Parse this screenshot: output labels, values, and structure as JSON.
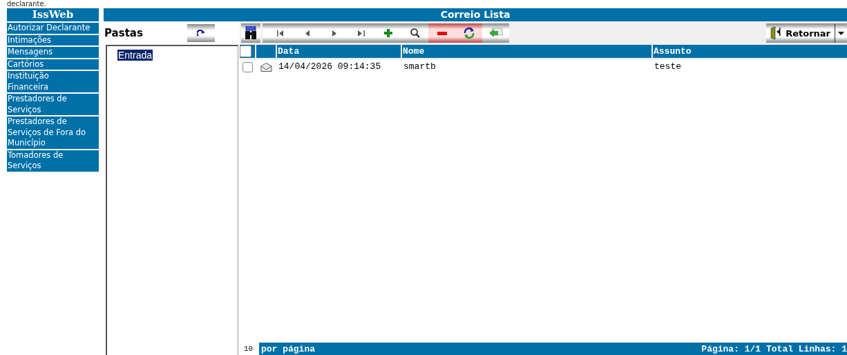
{
  "top_text": "declarante.",
  "sidebar": {
    "title": "IssWeb",
    "items": [
      {
        "label": "Autorizar Declarante"
      },
      {
        "label": "Intimações"
      },
      {
        "label": "Mensagens"
      },
      {
        "label": "Cartórios"
      },
      {
        "label": "Instituição Financeira"
      },
      {
        "label": "Prestadores de Serviços"
      },
      {
        "label": "Prestadores de Serviços de Fora do Município"
      },
      {
        "label": "Tomadores de Serviços"
      }
    ]
  },
  "main": {
    "title": "Correio Lista"
  },
  "folders": {
    "label": "Pastas",
    "items": [
      {
        "label": "Entrada",
        "selected": true
      }
    ]
  },
  "toolbar": {
    "return_button": "Retornar"
  },
  "table": {
    "header_checked": false,
    "columns": [
      "Data",
      "Nome",
      "Assunto"
    ],
    "rows": [
      {
        "checked": false,
        "data": "14/04/2026 09:14:35",
        "nome": "smartb",
        "assunto": "teste"
      }
    ]
  },
  "footer": {
    "page_size": "10",
    "page_size_label": "por página",
    "pagination": "Página: 1/1 Total Linhas: 1"
  }
}
